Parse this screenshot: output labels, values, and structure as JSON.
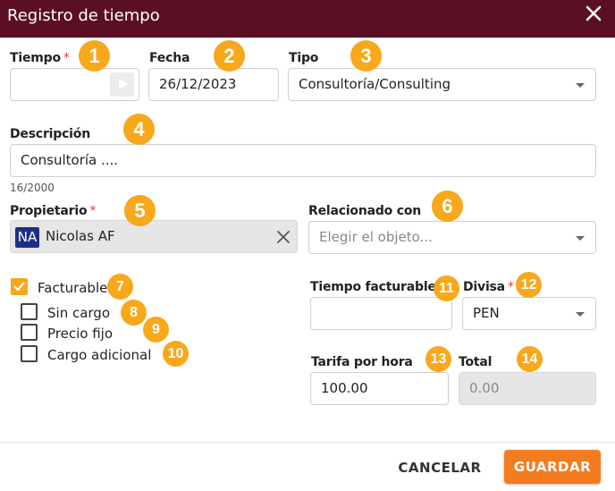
{
  "dialog": {
    "title": "Registro de tiempo",
    "close_icon": "close-icon"
  },
  "fields": {
    "tiempo": {
      "label": "Tiempo",
      "required_mark": "*",
      "value": "",
      "play_icon": "play-icon"
    },
    "fecha": {
      "label": "Fecha",
      "value": "26/12/2023"
    },
    "tipo": {
      "label": "Tipo",
      "value": "Consultoría/Consulting"
    },
    "descripcion": {
      "label": "Descripción",
      "value": "Consultoría ....",
      "counter": "16/2000"
    },
    "propietario": {
      "label": "Propietario",
      "required_mark": "*",
      "avatar_initials": "NA",
      "value": "Nicolas AF"
    },
    "relacionado": {
      "label": "Relacionado con",
      "placeholder": "Elegir el objeto..."
    },
    "tiempo_facturable": {
      "label": "Tiempo facturable",
      "required_mark": "*",
      "value": ""
    },
    "divisa": {
      "label": "Divisa",
      "required_mark": "*",
      "value": "PEN"
    },
    "tarifa": {
      "label": "Tarifa por hora",
      "value": "100.00"
    },
    "total": {
      "label": "Total",
      "value": "0.00"
    }
  },
  "checkboxes": {
    "facturable": {
      "label": "Facturable",
      "checked": true
    },
    "sin_cargo": {
      "label": "Sin cargo",
      "checked": false
    },
    "precio_fijo": {
      "label": "Precio fijo",
      "checked": false
    },
    "cargo_adicional": {
      "label": "Cargo adicional",
      "checked": false
    }
  },
  "badges": [
    "1",
    "2",
    "3",
    "4",
    "5",
    "6",
    "7",
    "8",
    "9",
    "10",
    "11",
    "12",
    "13",
    "14"
  ],
  "actions": {
    "cancel": "CANCELAR",
    "save": "GUARDAR"
  },
  "colors": {
    "header": "#5a0f23",
    "accent": "#f7a81b",
    "save": "#f47c20",
    "avatar": "#1e2f86",
    "required": "#e53935"
  }
}
